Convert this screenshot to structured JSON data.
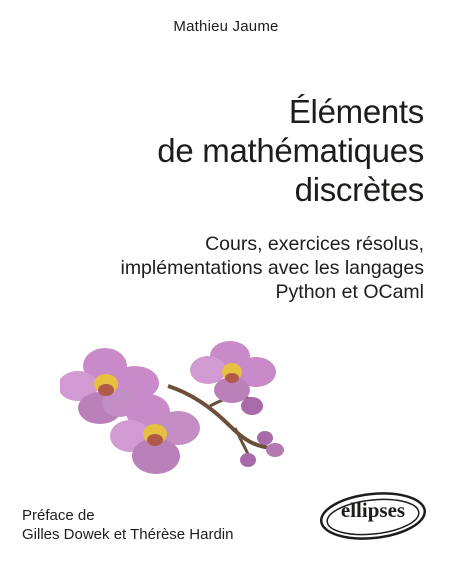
{
  "author": "Mathieu Jaume",
  "title_lines": [
    "Éléments",
    "de mathématiques",
    "discrètes"
  ],
  "subtitle_lines": [
    "Cours, exercices résolus,",
    "implémentations avec les langages",
    "Python et OCaml"
  ],
  "preface_lines": [
    "Préface de",
    "Gilles Dowek et Thérèse Hardin"
  ],
  "publisher": "ellipses",
  "illustration": "orchid-flowers",
  "colors": {
    "text": "#1d1d1b",
    "petal": "#c88ac8",
    "petal_dark": "#a86aa9",
    "lip": "#e8c040",
    "stem": "#6b4f3a"
  }
}
